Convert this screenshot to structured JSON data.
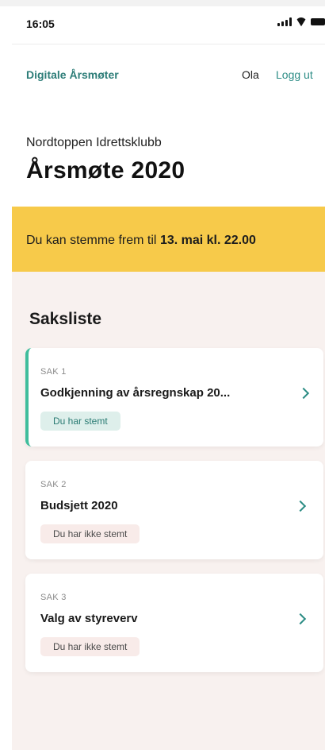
{
  "status_bar": {
    "time": "16:05"
  },
  "nav": {
    "brand": "Digitale Årsmøter",
    "user": "Ola",
    "logout": "Logg ut"
  },
  "header": {
    "org": "Nordtoppen Idrettsklubb",
    "title_prefix": "Årsmøte",
    "title_year": "2020"
  },
  "banner": {
    "text": "Du kan stemme frem til",
    "deadline": "13. mai kl. 22.00"
  },
  "agenda": {
    "heading": "Saksliste",
    "items": [
      {
        "sak": "SAK 1",
        "name": "Godkjenning av årsregnskap 20...",
        "status": "Du har stemt",
        "voted": true
      },
      {
        "sak": "SAK 2",
        "name": "Budsjett 2020",
        "status": "Du har ikke stemt",
        "voted": false
      },
      {
        "sak": "SAK 3",
        "name": "Valg av styreverv",
        "status": "Du har ikke stemt",
        "voted": false
      }
    ]
  },
  "colors": {
    "brand": "#2d7d78",
    "banner": "#f7ca4a",
    "voted_accent": "#3fbd9c",
    "content_bg": "#f8f1ef"
  }
}
